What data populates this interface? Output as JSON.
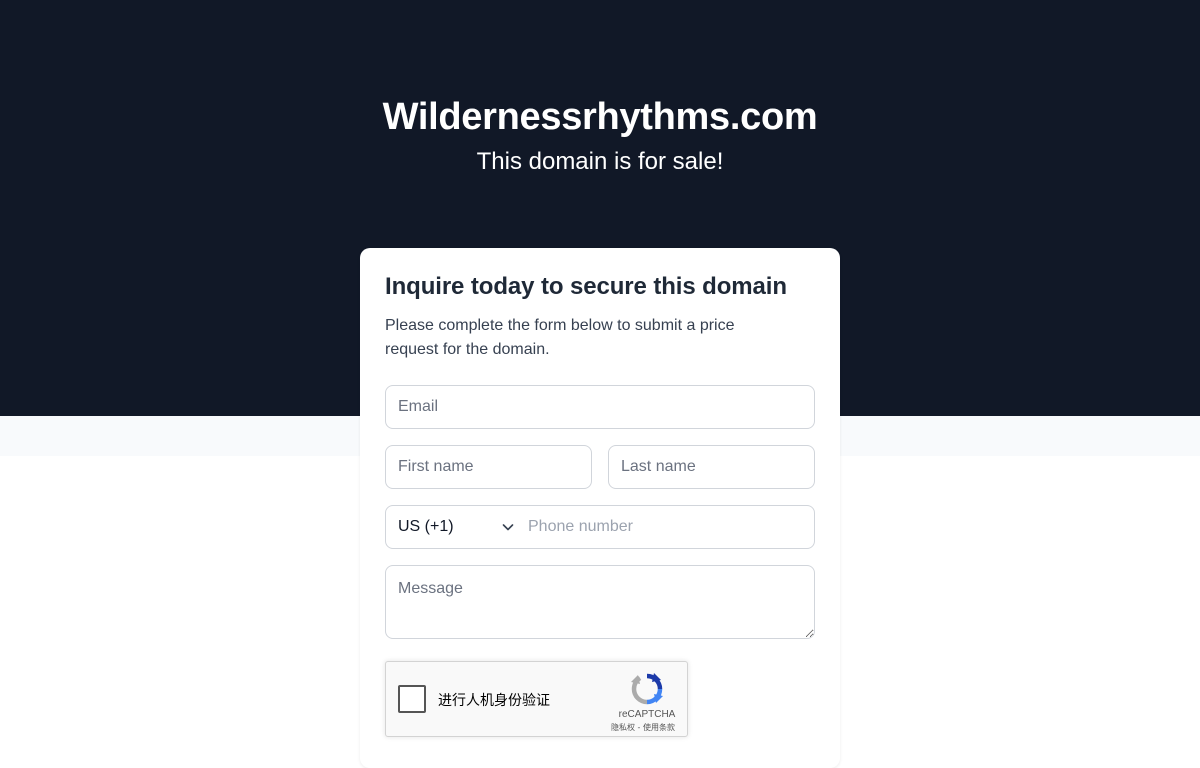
{
  "hero": {
    "title": "Wildernessrhythms.com",
    "subtitle": "This domain is for sale!"
  },
  "form": {
    "heading": "Inquire today to secure this domain",
    "description": "Please complete the form below to submit a price request for the domain.",
    "email_placeholder": "Email",
    "first_name_placeholder": "First name",
    "last_name_placeholder": "Last name",
    "country_code": "US (+1)",
    "phone_placeholder": "Phone number",
    "message_placeholder": "Message"
  },
  "captcha": {
    "label": "进行人机身份验证",
    "brand": "reCAPTCHA",
    "links": "隐私权 - 使用条款"
  },
  "icons": {
    "country_chevron": "chevron-down-icon",
    "recaptcha_logo": "recaptcha-logo-icon"
  },
  "colors": {
    "hero_background": "#111827",
    "band_background": "#f8fafc",
    "card_background": "#ffffff",
    "heading_text": "#1f2937"
  }
}
